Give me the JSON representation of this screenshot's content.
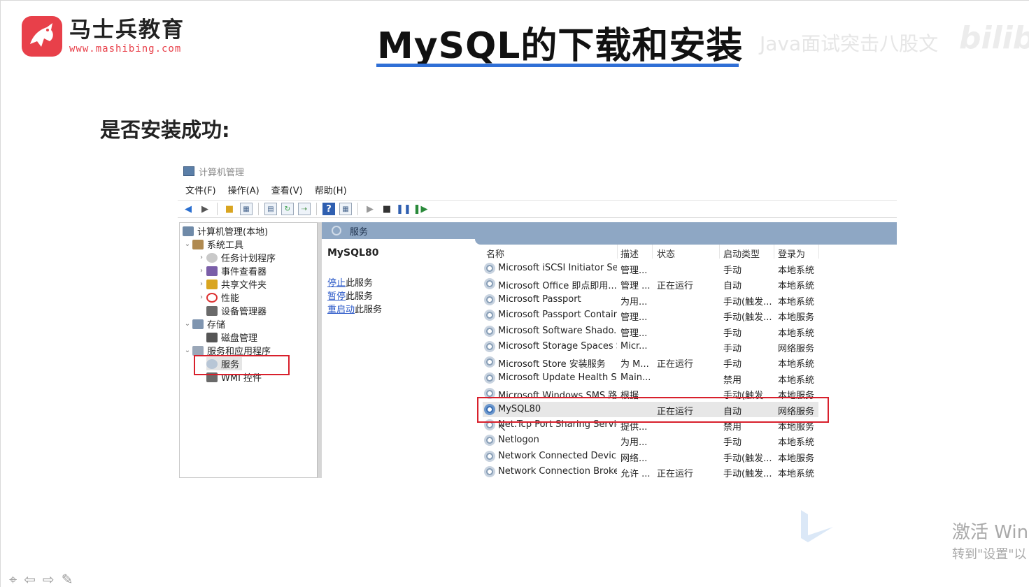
{
  "brand": {
    "name": "马士兵教育",
    "url": "www.mashibing.com"
  },
  "slide": {
    "title": "MySQL的下载和安装",
    "subtitle": "是否安装成功:",
    "watermark": "Java面试突击八股文",
    "watermark_site": "bilibili"
  },
  "window": {
    "title": "计算机管理",
    "menu": [
      "文件(F)",
      "操作(A)",
      "查看(V)",
      "帮助(H)"
    ],
    "toolbar_icons": [
      "back-arrow-icon",
      "forward-arrow-icon",
      "up-folder-icon",
      "show-tree-icon",
      "properties-icon",
      "refresh-icon",
      "export-icon",
      "help-icon",
      "console-icon",
      "play-icon",
      "stop-icon",
      "pause-icon",
      "resume-icon"
    ]
  },
  "tree": [
    {
      "label": "计算机管理(本地)"
    },
    {
      "label": "系统工具"
    },
    {
      "label": "任务计划程序"
    },
    {
      "label": "事件查看器"
    },
    {
      "label": "共享文件夹"
    },
    {
      "label": "性能"
    },
    {
      "label": "设备管理器"
    },
    {
      "label": "存储"
    },
    {
      "label": "磁盘管理"
    },
    {
      "label": "服务和应用程序"
    },
    {
      "label": "服务"
    },
    {
      "label": "WMI 控件"
    }
  ],
  "services_pane": {
    "header": "服务",
    "selected_name": "MySQL80",
    "actions": [
      {
        "link": "停止",
        "text": "此服务"
      },
      {
        "link": "暂停",
        "text": "此服务"
      },
      {
        "link": "重启动",
        "text": "此服务"
      }
    ],
    "columns": [
      "名称",
      "描述",
      "状态",
      "启动类型",
      "登录为"
    ],
    "rows": [
      {
        "name": "Microsoft iSCSI Initiator Ser...",
        "desc": "管理...",
        "status": "",
        "startup": "手动",
        "logon": "本地系统"
      },
      {
        "name": "Microsoft Office 即点即用...",
        "desc": "管理 ...",
        "status": "正在运行",
        "startup": "自动",
        "logon": "本地系统"
      },
      {
        "name": "Microsoft Passport",
        "desc": "为用...",
        "status": "",
        "startup": "手动(触发...",
        "logon": "本地系统"
      },
      {
        "name": "Microsoft Passport Container",
        "desc": "管理...",
        "status": "",
        "startup": "手动(触发...",
        "logon": "本地服务"
      },
      {
        "name": "Microsoft Software Shado...",
        "desc": "管理...",
        "status": "",
        "startup": "手动",
        "logon": "本地系统"
      },
      {
        "name": "Microsoft Storage Spaces S...",
        "desc": "Micr...",
        "status": "",
        "startup": "手动",
        "logon": "网络服务"
      },
      {
        "name": "Microsoft Store 安装服务",
        "desc": "为 M...",
        "status": "正在运行",
        "startup": "手动",
        "logon": "本地系统"
      },
      {
        "name": "Microsoft Update Health S...",
        "desc": "Main...",
        "status": "",
        "startup": "禁用",
        "logon": "本地系统"
      },
      {
        "name": "Microsoft Windows SMS 路...",
        "desc": "根据...",
        "status": "",
        "startup": "手动(触发...",
        "logon": "本地服务"
      },
      {
        "name": "MySQL80",
        "desc": "",
        "status": "正在运行",
        "startup": "自动",
        "logon": "网络服务"
      },
      {
        "name": "Net.Tcp Port Sharing Service",
        "desc": "提供...",
        "status": "",
        "startup": "禁用",
        "logon": "本地服务"
      },
      {
        "name": "Netlogon",
        "desc": "为用...",
        "status": "",
        "startup": "手动",
        "logon": "本地系统"
      },
      {
        "name": "Network Connected Devic...",
        "desc": "网络...",
        "status": "",
        "startup": "手动(触发...",
        "logon": "本地服务"
      },
      {
        "name": "Network Connection Broker",
        "desc": "允许 ...",
        "status": "正在运行",
        "startup": "手动(触发...",
        "logon": "本地系统"
      }
    ]
  },
  "overlay": {
    "activate_title": "激活 Win",
    "activate_sub": "转到\"设置\"以"
  },
  "colors": {
    "brand_red": "#e8404a",
    "title_underline": "#2f6fd6",
    "highlight_red": "#d8202c",
    "header_blue": "#8ea7c4",
    "link_blue": "#2a58c8"
  }
}
